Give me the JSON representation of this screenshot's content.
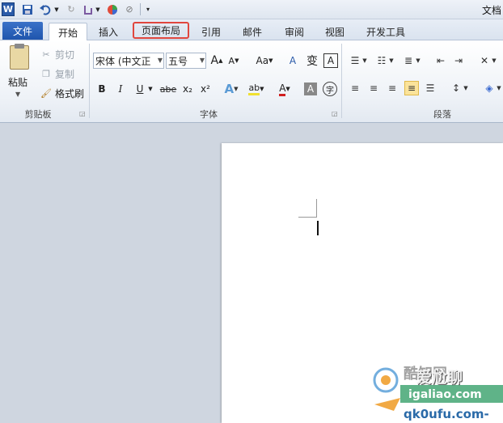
{
  "qat": {
    "app_icon": "W",
    "title_partial": "文档"
  },
  "tabs": [
    "文件",
    "开始",
    "插入",
    "页面布局",
    "引用",
    "邮件",
    "审阅",
    "视图",
    "开发工具"
  ],
  "clipboard": {
    "paste": "粘贴",
    "cut": "剪切",
    "copy": "复制",
    "format_painter": "格式刷",
    "group_label": "剪贴板"
  },
  "font": {
    "family": "宋体 (中文正文)",
    "family_visible": "宋体 (中文正",
    "size": "五号",
    "grow": "A",
    "shrink": "A",
    "change_case": "Aa",
    "clear_format": "A",
    "phonetic": "变",
    "char_border": "A",
    "bold": "B",
    "italic": "I",
    "underline": "U",
    "strike": "abe",
    "subscript": "x₂",
    "superscript": "x²",
    "text_effect": "A",
    "highlight": "ab",
    "font_color": "A",
    "char_shading": "A",
    "enclose": "字",
    "group_label": "字体"
  },
  "paragraph": {
    "group_label": "段落"
  },
  "watermark": {
    "line1": "爱尬聊",
    "line2": "igaliao.com",
    "line3": "qk0ufu.com-",
    "brand": "酷知网"
  },
  "colors": {
    "file_tab": "#2a5ab0",
    "highlight_box": "#e0463e",
    "active_para": "#fbe39a"
  }
}
